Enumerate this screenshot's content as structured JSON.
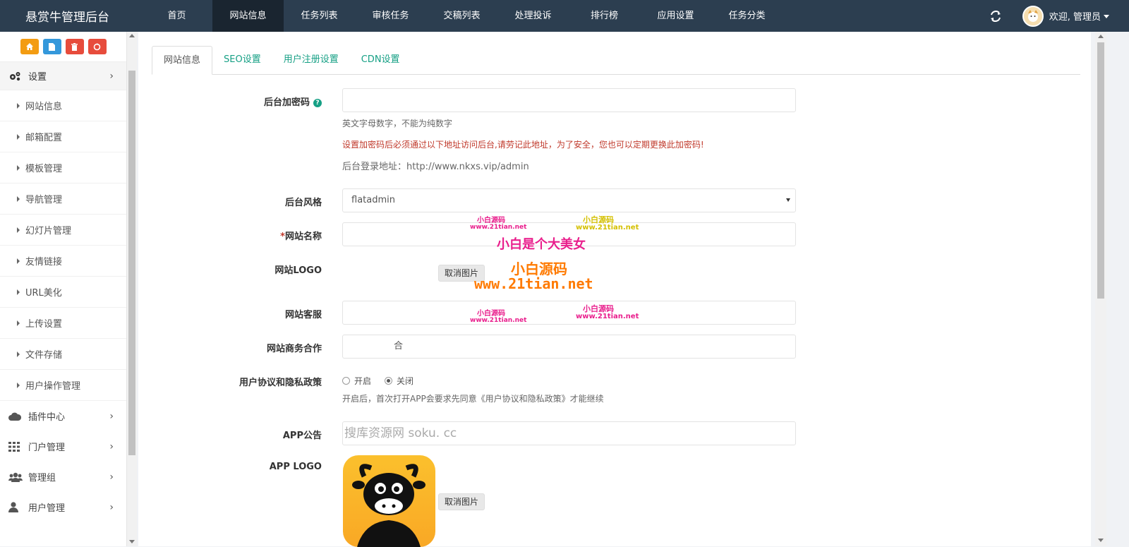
{
  "app": {
    "title": "悬赏牛管理后台"
  },
  "topnav": {
    "items": [
      "首页",
      "网站信息",
      "任务列表",
      "审核任务",
      "交稿列表",
      "处理投诉",
      "排行榜",
      "应用设置",
      "任务分类"
    ],
    "active_index": 1,
    "welcome": "欢迎, 管理员"
  },
  "sidebar": {
    "settings_label": "设置",
    "sub_items": [
      "网站信息",
      "邮箱配置",
      "模板管理",
      "导航管理",
      "幻灯片管理",
      "友情链接",
      "URL美化",
      "上传设置",
      "文件存储",
      "用户操作管理"
    ],
    "groups": [
      "插件中心",
      "门户管理",
      "管理组",
      "用户管理"
    ]
  },
  "tabs": [
    "网站信息",
    "SEO设置",
    "用户注册设置",
    "CDN设置"
  ],
  "form": {
    "admin_code": {
      "label": "后台加密码",
      "hint1": "英文字母数字，不能为纯数字",
      "hint2": "设置加密码后必须通过以下地址访问后台,请劳记此地址，为了安全，您也可以定期更换此加密码!",
      "hint3": "后台登录地址：http://www.nkxs.vip/admin"
    },
    "admin_style": {
      "label": "后台风格",
      "value": "flatadmin"
    },
    "site_name": {
      "label": "网站名称",
      "required_mark": "*"
    },
    "site_logo": {
      "label": "网站LOGO",
      "cancel_button": "取消图片"
    },
    "site_service": {
      "label": "网站客服"
    },
    "site_business": {
      "label": "网站商务合作",
      "partial_text": "合"
    },
    "policy": {
      "label": "用户协议和隐私政策",
      "option_on": "开启",
      "option_off": "关闭",
      "selected": "关闭",
      "hint": "开启后，首次打开APP会要求先同意《用户协议和隐私政策》才能继续"
    },
    "app_notice": {
      "label": "APP公告",
      "value": "搜库资源网  soku. cc"
    },
    "app_logo": {
      "label": "APP LOGO",
      "cancel_button": "取消图片"
    }
  },
  "watermarks": {
    "small_cn": "小白源码",
    "small_url": "www.21tian.net",
    "slogan": "小白是个大美女",
    "big_cn": "小白源码",
    "big_url": "www.21tian.net"
  },
  "colors": {
    "topbar": "#2c3e50",
    "accent": "#16a085",
    "warning": "#c0392b"
  }
}
